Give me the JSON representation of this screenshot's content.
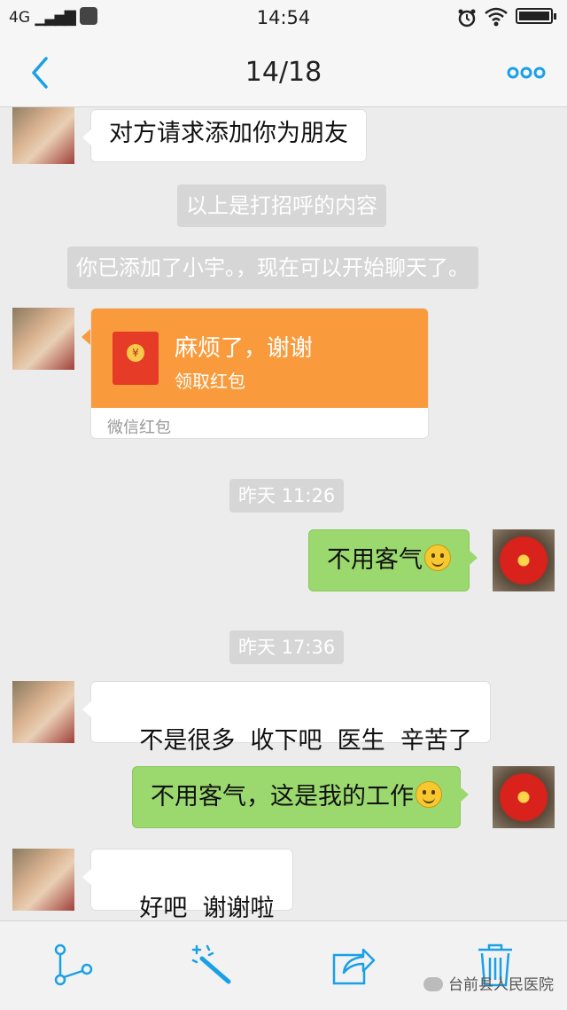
{
  "status_bar": {
    "network": "4G",
    "time": "14:54"
  },
  "nav": {
    "title": "14/18"
  },
  "messages": {
    "m1": "对方请求添加你为朋友",
    "sys1": "以上是打招呼的内容",
    "sys2": "你已添加了小宇。，现在可以开始聊天了。",
    "red_packet": {
      "message": "麻烦了，谢谢",
      "action": "领取红包",
      "footer": "微信红包",
      "coin": "¥"
    },
    "stamp1": "昨天 11:26",
    "m2": "不用客气",
    "stamp2": "昨天 17:36",
    "m3": "不是很多  收下吧  医生  辛苦了",
    "m4": "不用客气，这是我的工作",
    "m5": "好吧  谢谢啦"
  },
  "watermark": "台前县人民医院",
  "colors": {
    "accent": "#1aa0e6",
    "bubble_out": "#9bd86e",
    "red_packet": "#f99b3c"
  }
}
